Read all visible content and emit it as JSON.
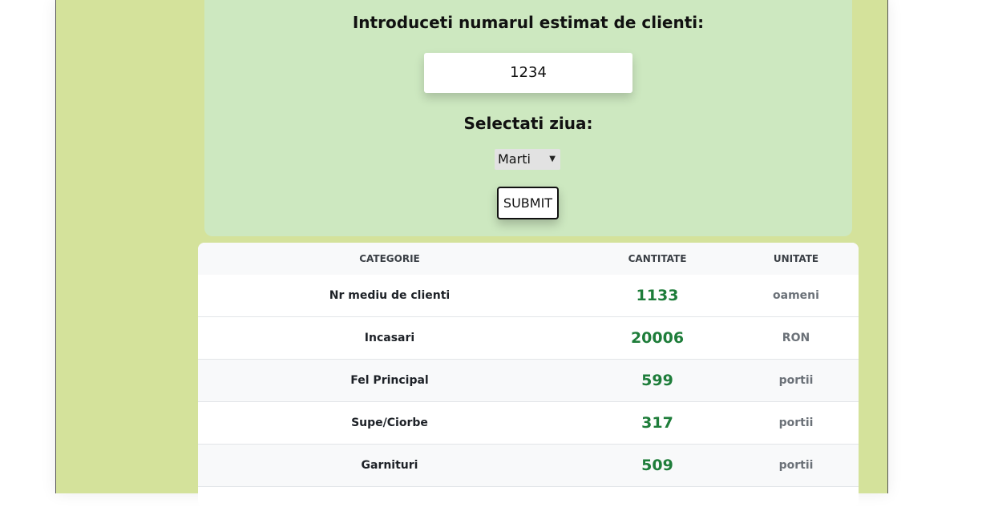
{
  "form": {
    "clients_label": "Introduceti numarul estimat de clienti:",
    "clients_value": "1234",
    "day_label": "Selectati ziua:",
    "day_selected": "Marti",
    "submit_label": "SUBMIT"
  },
  "table": {
    "headers": [
      "CATEGORIE",
      "CANTITATE",
      "UNITATE"
    ],
    "rows": [
      {
        "category": "Nr mediu de clienti",
        "quantity": "1133",
        "unit": "oameni"
      },
      {
        "category": "Incasari",
        "quantity": "20006",
        "unit": "RON"
      },
      {
        "category": "Fel Principal",
        "quantity": "599",
        "unit": "portii"
      },
      {
        "category": "Supe/Ciorbe",
        "quantity": "317",
        "unit": "portii"
      },
      {
        "category": "Garnituri",
        "quantity": "509",
        "unit": "portii"
      }
    ]
  },
  "colors": {
    "page_background": "#d4e29b",
    "form_background": "#cde8c0",
    "quantity_text": "#1e7d3a"
  }
}
